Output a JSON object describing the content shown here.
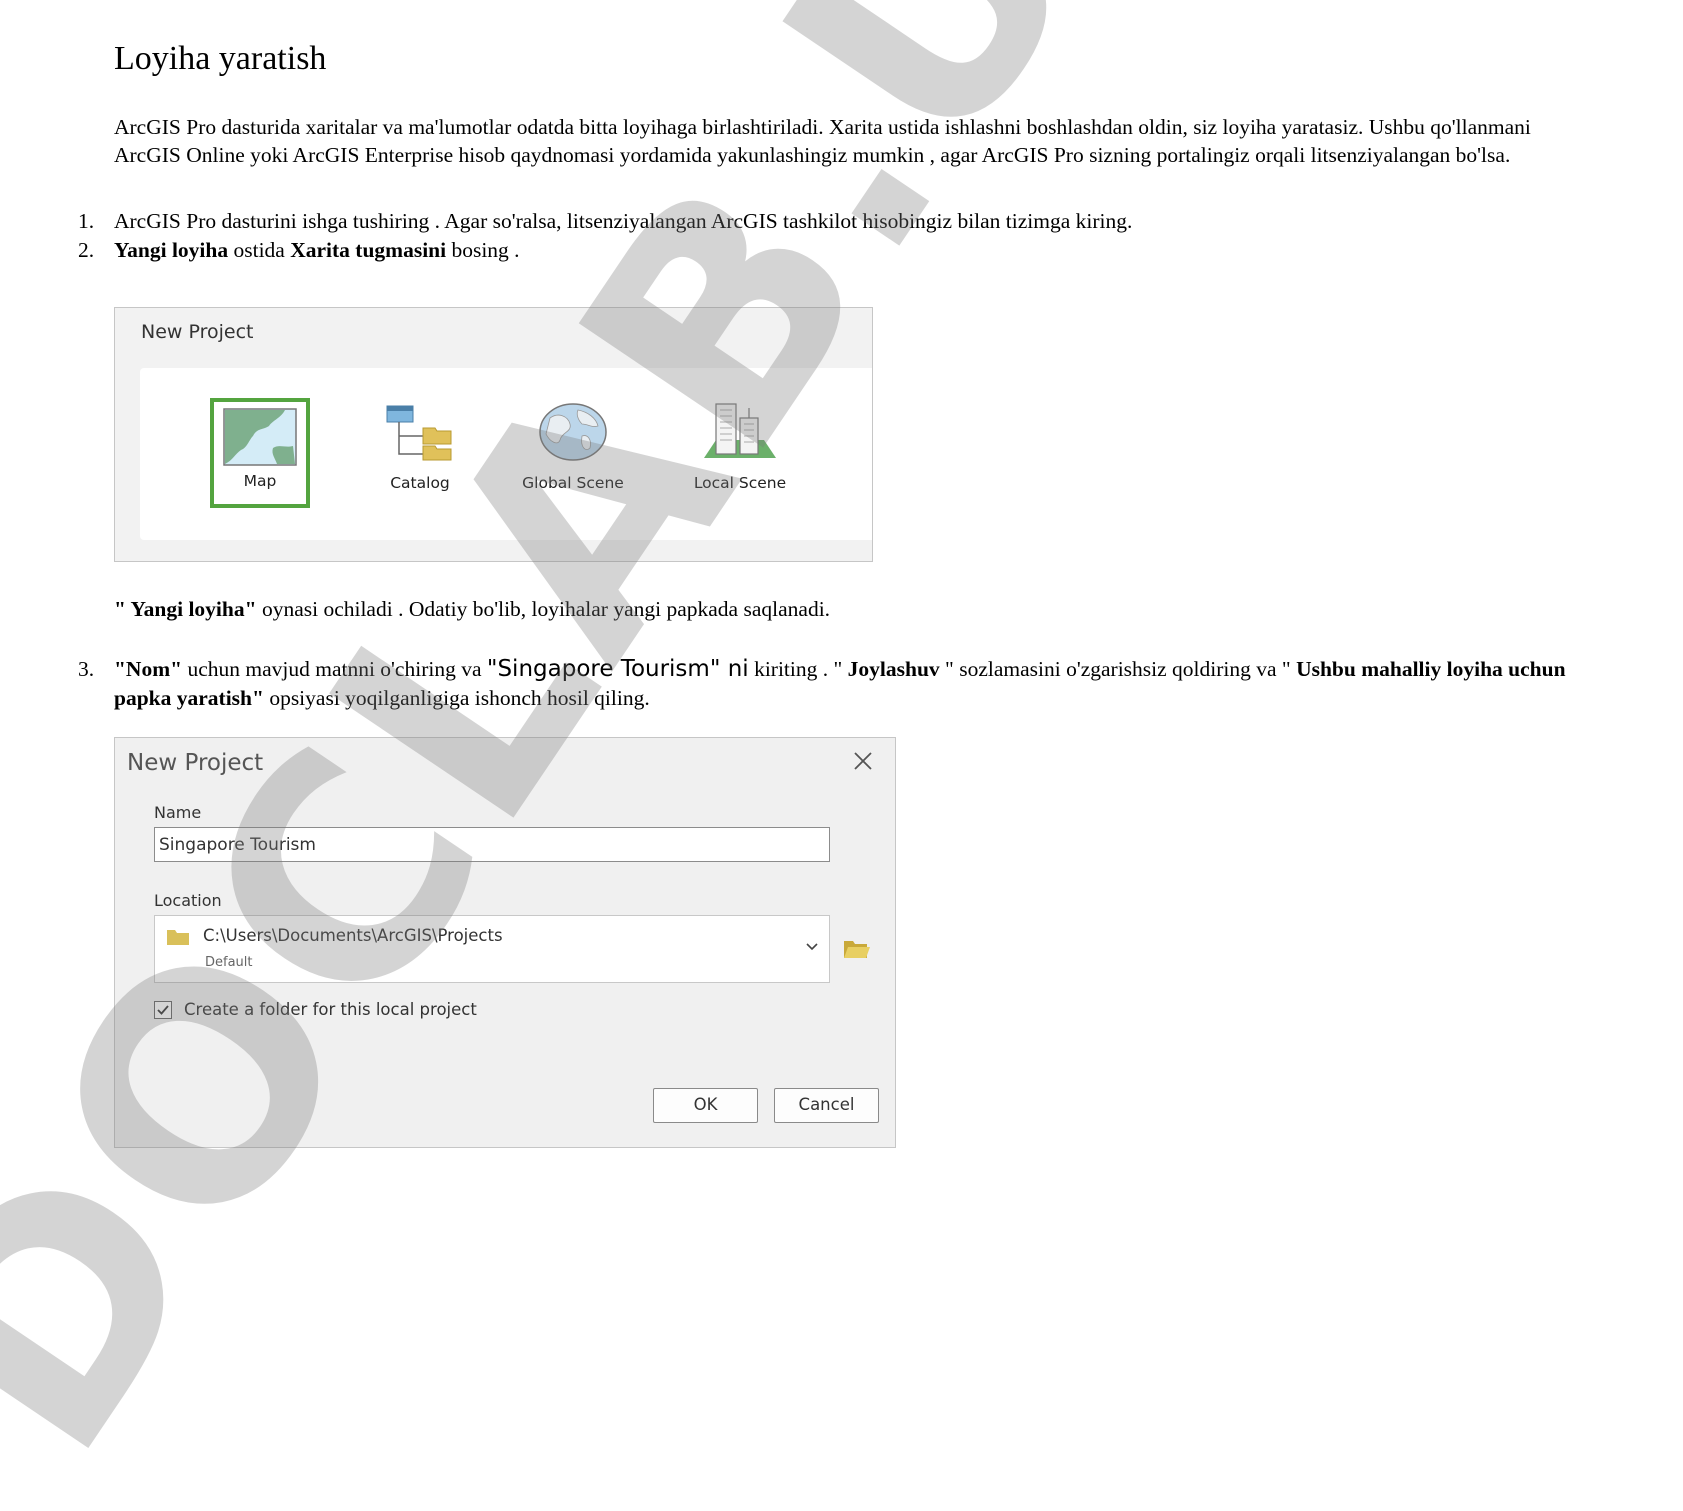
{
  "heading": "Loyiha yaratish",
  "intro": "ArcGIS Pro dasturida xaritalar va ma'lumotlar odatda bitta loyihaga birlashtiriladi. Xarita ustida ishlashni boshlashdan oldin, siz loyiha yaratasiz. Ushbu qo'llanmani ArcGIS Online yoki ArcGIS Enterprise hisob qaydnomasi yordamida yakunlashingiz mumkin , agar ArcGIS Pro sizning portalingiz orqali litsenziyalangan bo'lsa.",
  "steps": [
    {
      "num": "1.",
      "text": "ArcGIS Pro dasturini ishga tushiring . Agar so'ralsa, litsenziyalangan ArcGIS tashkilot hisobingiz bilan tizimga kiring."
    },
    {
      "num": "2.",
      "b1": "Yangi loyiha",
      "t1": " ostida ",
      "b2": "Xarita tugmasini",
      "t2": " bosing ."
    },
    {
      "num": "3.",
      "b1": "\"Nom\"",
      "t1": " uchun mavjud matnni o'chiring va ",
      "big": "\"Singapore Tourism\" ni",
      "t2": " kiriting . \" ",
      "b2": "Joylashuv",
      "t3": " \" sozlamasini o'zgarishsiz qoldiring va \" ",
      "b3": "Ushbu mahalliy loyiha uchun papka yaratish\"",
      "t4": " opsiyasi yoqilganligiga ishonch hosil qiling."
    }
  ],
  "note": {
    "b": "\" Yangi loyiha\"",
    "t": " oynasi ochiladi . Odatiy bo'lib, loyihalar yangi papkada saqlanadi."
  },
  "gallery": {
    "title": "New Project",
    "tiles": [
      {
        "label": "Map",
        "icon": "map-icon",
        "selected": true
      },
      {
        "label": "Catalog",
        "icon": "catalog-icon"
      },
      {
        "label": "Global Scene",
        "icon": "globe-icon"
      },
      {
        "label": "Local Scene",
        "icon": "buildings-icon"
      }
    ],
    "accent": "#54a43f"
  },
  "dialog": {
    "title": "New Project",
    "name_label": "Name",
    "name_value": "Singapore Tourism",
    "location_label": "Location",
    "location_path": "C:\\Users\\Documents\\ArcGIS\\Projects",
    "location_sub": "Default",
    "checkbox_label": "Create a folder for this local project",
    "checkbox_checked": true,
    "ok_label": "OK",
    "cancel_label": "Cancel"
  },
  "watermark": "DOCLAB.UZ"
}
